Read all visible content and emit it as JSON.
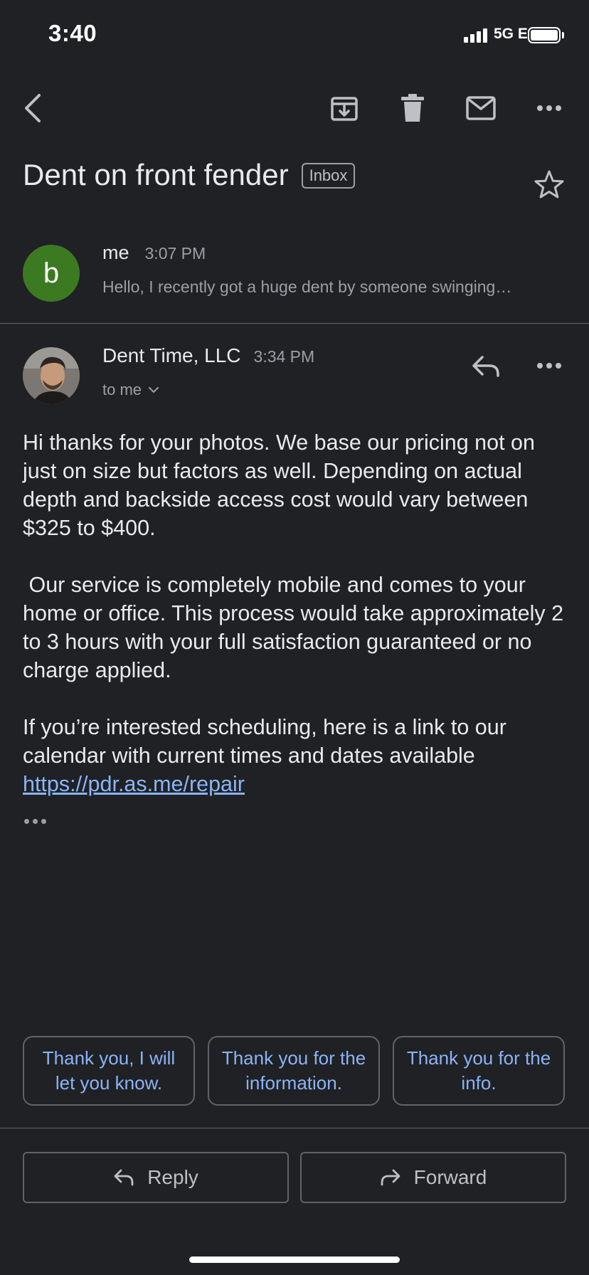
{
  "status_bar": {
    "time": "3:40",
    "network": "5G E"
  },
  "toolbar": {
    "back_icon": "chevron-left-icon",
    "archive_icon": "archive-icon",
    "delete_icon": "trash-icon",
    "mark_unread_icon": "mail-icon",
    "more_icon": "more-horizontal-icon"
  },
  "subject": {
    "text": "Dent on front fender",
    "label": "Inbox",
    "star_icon": "star-outline-icon"
  },
  "messages": [
    {
      "avatar_letter": "b",
      "avatar_color": "#3c7a22",
      "sender": "me",
      "time": "3:07 PM",
      "snippet": "Hello, I recently got a huge dent by someone swinging…"
    },
    {
      "sender": "Dent Time, LLC",
      "time": "3:34 PM",
      "recipient": "to me",
      "paragraphs": [
        "Hi thanks for your photos. We base our pricing not on just on size but factors as well. Depending on actual depth and backside access cost would vary between $325 to $400.",
        " Our service is completely mobile and comes to your home or office. This process would take approximately 2 to 3 hours with your full satisfaction guaranteed or no charge applied.",
        "If you’re interested scheduling, here is a link to our calendar with current times and dates available"
      ],
      "link": "https://pdr.as.me/repair"
    }
  ],
  "smart_replies": [
    "Thank you, I will let you know.",
    "Thank you for the information.",
    "Thank you for the info."
  ],
  "actions": {
    "reply": "Reply",
    "forward": "Forward"
  },
  "colors": {
    "background": "#202124",
    "link": "#8ab4f8",
    "text": "#e8eaed",
    "muted": "#9aa0a6"
  }
}
